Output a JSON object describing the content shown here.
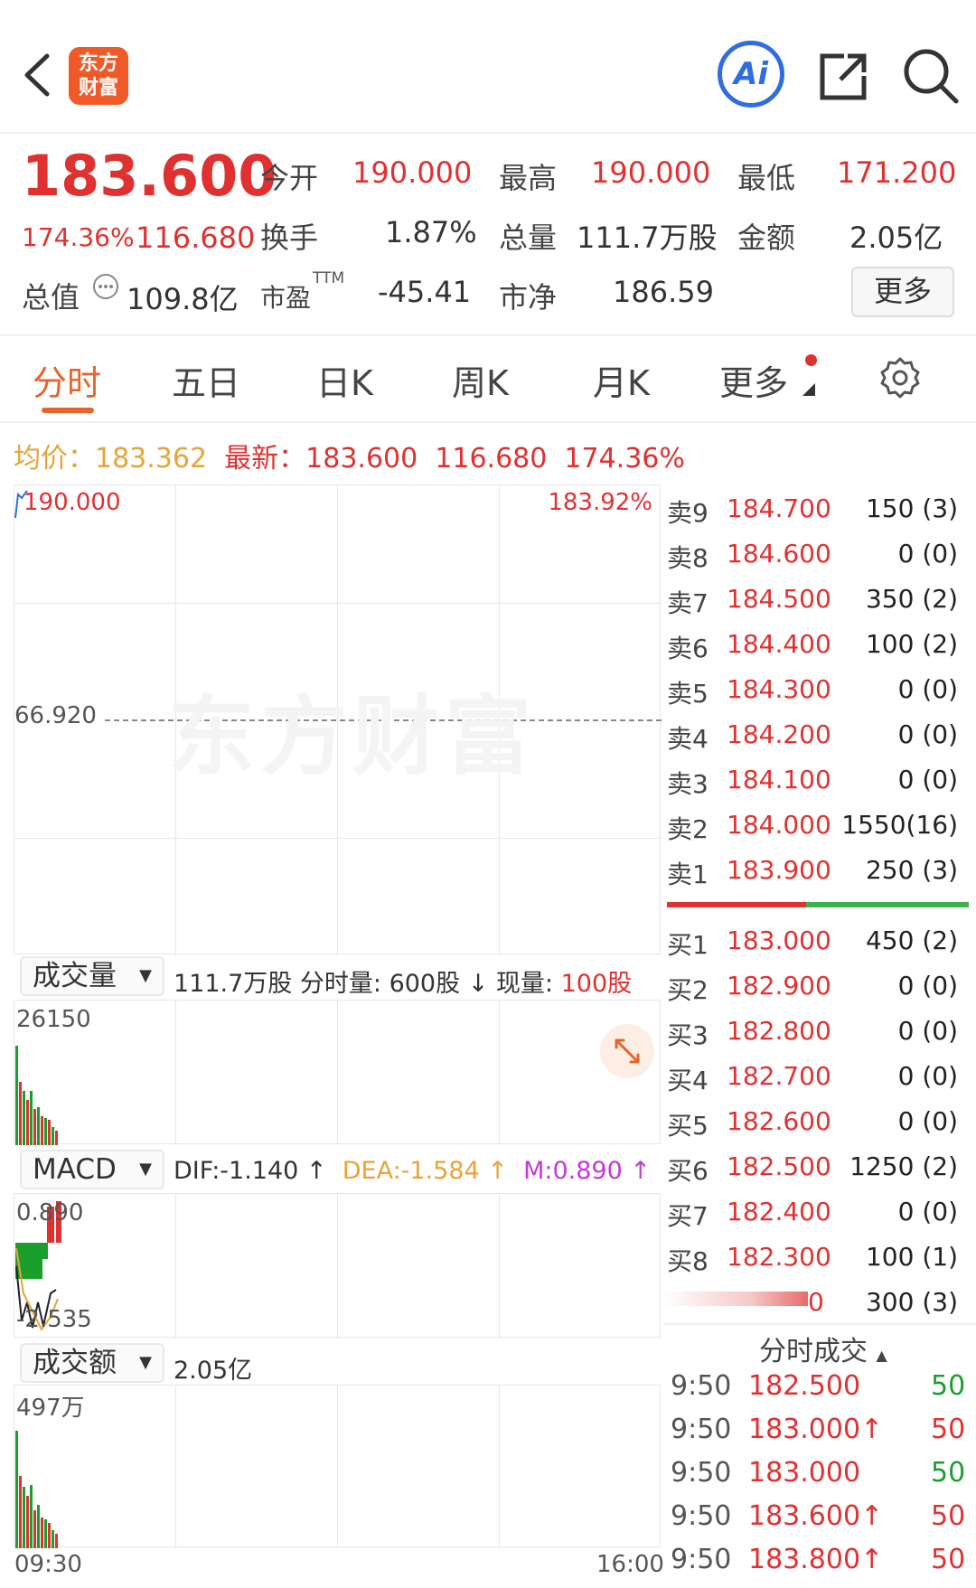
{
  "header": {
    "back_icon": "chevron-left-icon",
    "logo_text_line1": "东方",
    "logo_text_line2": "财富",
    "ai_label": "Ai",
    "share_icon": "share-icon",
    "search_icon": "search-icon"
  },
  "quote": {
    "price": "183.600",
    "change_pct": "174.36%",
    "change_amt": "116.680",
    "open_label": "今开",
    "open": "190.000",
    "high_label": "最高",
    "high": "190.000",
    "low_label": "最低",
    "low": "171.200",
    "turnover_label": "换手",
    "turnover": "1.87%",
    "volume_label": "总量",
    "volume": "111.7万股",
    "amount_label": "金额",
    "amount": "2.05亿",
    "mktcap_label": "总值",
    "mktcap": "109.8亿",
    "pe_label": "市盈",
    "pe_sup": "TTM",
    "pe": "-45.41",
    "pb_label": "市净",
    "pb": "186.59",
    "more_button": "更多"
  },
  "tabs": [
    {
      "label": "分时",
      "active": true
    },
    {
      "label": "五日"
    },
    {
      "label": "日K"
    },
    {
      "label": "周K"
    },
    {
      "label": "月K"
    },
    {
      "label": "更多"
    }
  ],
  "settings_icon": "gear-icon",
  "avg_line": {
    "avg_label": "均价：",
    "avg": "183.362",
    "latest_label": "最新：",
    "latest": "183.600",
    "change_amt": "116.680",
    "change_pct": "174.36%"
  },
  "price_chart": {
    "top_left": "190.000",
    "top_right": "183.92%",
    "mid_left": "66.920",
    "watermark": "东方财富"
  },
  "volume_panel": {
    "selector": "成交量",
    "info_total": "111.7万股",
    "info_minute": "分时量: 600股",
    "info_now_label": "现量: ",
    "info_now": "100股",
    "max": "26150",
    "expand_icon": "expand-icon"
  },
  "macd_panel": {
    "selector": "MACD",
    "dif": "DIF:-1.140",
    "dea": "DEA:-1.584",
    "m": "M:0.890",
    "top": "0.890",
    "bottom": "-2.535"
  },
  "amount_panel": {
    "selector": "成交额",
    "value": "2.05亿",
    "max": "497万",
    "time_start": "09:30",
    "time_end": "16:00"
  },
  "order_book": {
    "asks": [
      {
        "label": "卖9",
        "price": "184.700",
        "vol": "150 (3)"
      },
      {
        "label": "卖8",
        "price": "184.600",
        "vol": "0 (0)"
      },
      {
        "label": "卖7",
        "price": "184.500",
        "vol": "350 (2)"
      },
      {
        "label": "卖6",
        "price": "184.400",
        "vol": "100 (2)"
      },
      {
        "label": "卖5",
        "price": "184.300",
        "vol": "0 (0)"
      },
      {
        "label": "卖4",
        "price": "184.200",
        "vol": "0 (0)"
      },
      {
        "label": "卖3",
        "price": "184.100",
        "vol": "0 (0)"
      },
      {
        "label": "卖2",
        "price": "184.000",
        "vol": "1550(16)"
      },
      {
        "label": "卖1",
        "price": "183.900",
        "vol": "250 (3)"
      }
    ],
    "bids": [
      {
        "label": "买1",
        "price": "183.000",
        "vol": "450 (2)"
      },
      {
        "label": "买2",
        "price": "182.900",
        "vol": "0 (0)"
      },
      {
        "label": "买3",
        "price": "182.800",
        "vol": "0 (0)"
      },
      {
        "label": "买4",
        "price": "182.700",
        "vol": "0 (0)"
      },
      {
        "label": "买5",
        "price": "182.600",
        "vol": "0 (0)"
      },
      {
        "label": "买6",
        "price": "182.500",
        "vol": "1250 (2)"
      },
      {
        "label": "买7",
        "price": "182.400",
        "vol": "0 (0)"
      },
      {
        "label": "买8",
        "price": "182.300",
        "vol": "100 (1)"
      },
      {
        "label": "",
        "price": "0",
        "vol": "300 (3)"
      }
    ]
  },
  "trades": {
    "title": "分时成交",
    "rows": [
      {
        "time": "9:50",
        "price": "182.500",
        "vol": "50",
        "color": "#1a9e2c"
      },
      {
        "time": "9:50",
        "price": "183.000↑",
        "vol": "50",
        "color": "#e03131"
      },
      {
        "time": "9:50",
        "price": "183.000",
        "vol": "50",
        "color": "#1a9e2c"
      },
      {
        "time": "9:50",
        "price": "183.600↑",
        "vol": "50",
        "color": "#e03131"
      },
      {
        "time": "9:50",
        "price": "183.800↑",
        "vol": "50",
        "color": "#e03131"
      }
    ]
  },
  "colors": {
    "up": "#e03131",
    "down": "#1a9e2c",
    "accent": "#e8642c",
    "ai": "#2f6de0"
  }
}
